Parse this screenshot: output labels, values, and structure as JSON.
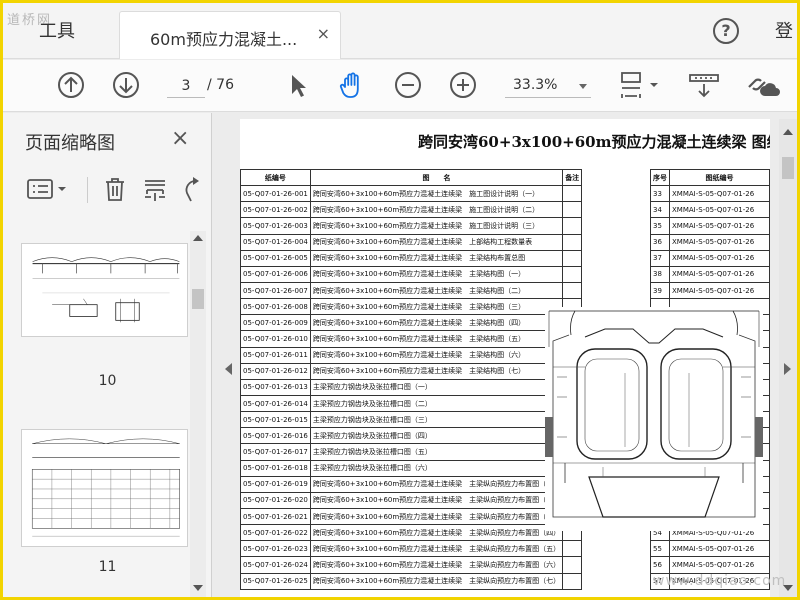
{
  "topbar": {
    "watermark": "道桥网",
    "tools_label": "工具",
    "tab_label": "60m预应力混凝土...",
    "tab_close": "×",
    "help_label": "?",
    "login_label": "登"
  },
  "toolbar": {
    "current_page": "3",
    "total_pages": "/ 76",
    "zoom": "33.3%"
  },
  "panel": {
    "title": "页面缩略图",
    "close": "×",
    "thumbnails": [
      {
        "page": "10"
      },
      {
        "page": "11"
      }
    ]
  },
  "document": {
    "title": "跨同安湾60+3x100+60m预应力混凝土连续梁 图纸",
    "left_headers": [
      "纸编号",
      "图　　名",
      "备注"
    ],
    "rows": [
      {
        "code": "05-Q07-01-26-001",
        "name": "跨同安湾60+3x100+60m预应力混凝土连续梁　施工图设计说明（一）"
      },
      {
        "code": "05-Q07-01-26-002",
        "name": "跨同安湾60+3x100+60m预应力混凝土连续梁　施工图设计说明（二）"
      },
      {
        "code": "05-Q07-01-26-003",
        "name": "跨同安湾60+3x100+60m预应力混凝土连续梁　施工图设计说明（三）"
      },
      {
        "code": "05-Q07-01-26-004",
        "name": "跨同安湾60+3x100+60m预应力混凝土连续梁　上部结构工程数量表"
      },
      {
        "code": "05-Q07-01-26-005",
        "name": "跨同安湾60+3x100+60m预应力混凝土连续梁　主梁结构布置总图"
      },
      {
        "code": "05-Q07-01-26-006",
        "name": "跨同安湾60+3x100+60m预应力混凝土连续梁　主梁结构图（一）"
      },
      {
        "code": "05-Q07-01-26-007",
        "name": "跨同安湾60+3x100+60m预应力混凝土连续梁　主梁结构图（二）"
      },
      {
        "code": "05-Q07-01-26-008",
        "name": "跨同安湾60+3x100+60m预应力混凝土连续梁　主梁结构图（三）"
      },
      {
        "code": "05-Q07-01-26-009",
        "name": "跨同安湾60+3x100+60m预应力混凝土连续梁　主梁结构图（四）"
      },
      {
        "code": "05-Q07-01-26-010",
        "name": "跨同安湾60+3x100+60m预应力混凝土连续梁　主梁结构图（五）"
      },
      {
        "code": "05-Q07-01-26-011",
        "name": "跨同安湾60+3x100+60m预应力混凝土连续梁　主梁结构图（六）"
      },
      {
        "code": "05-Q07-01-26-012",
        "name": "跨同安湾60+3x100+60m预应力混凝土连续梁　主梁结构图（七）"
      },
      {
        "code": "05-Q07-01-26-013",
        "name": "主梁预应力钢齿块及张拉槽口图（一）"
      },
      {
        "code": "05-Q07-01-26-014",
        "name": "主梁预应力钢齿块及张拉槽口图（二）"
      },
      {
        "code": "05-Q07-01-26-015",
        "name": "主梁预应力钢齿块及张拉槽口图（三）"
      },
      {
        "code": "05-Q07-01-26-016",
        "name": "主梁预应力钢齿块及张拉槽口图（四）"
      },
      {
        "code": "05-Q07-01-26-017",
        "name": "主梁预应力钢齿块及张拉槽口图（五）"
      },
      {
        "code": "05-Q07-01-26-018",
        "name": "主梁预应力钢齿块及张拉槽口图（六）"
      },
      {
        "code": "05-Q07-01-26-019",
        "name": "跨同安湾60+3x100+60m预应力混凝土连续梁　主梁纵向预应力布置图（一）"
      },
      {
        "code": "05-Q07-01-26-020",
        "name": "跨同安湾60+3x100+60m预应力混凝土连续梁　主梁纵向预应力布置图（二）"
      },
      {
        "code": "05-Q07-01-26-021",
        "name": "跨同安湾60+3x100+60m预应力混凝土连续梁　主梁纵向预应力布置图（三）"
      },
      {
        "code": "05-Q07-01-26-022",
        "name": "跨同安湾60+3x100+60m预应力混凝土连续梁　主梁纵向预应力布置图（四）"
      },
      {
        "code": "05-Q07-01-26-023",
        "name": "跨同安湾60+3x100+60m预应力混凝土连续梁　主梁纵向预应力布置图（五）"
      },
      {
        "code": "05-Q07-01-26-024",
        "name": "跨同安湾60+3x100+60m预应力混凝土连续梁　主梁纵向预应力布置图（六）"
      },
      {
        "code": "05-Q07-01-26-025",
        "name": "跨同安湾60+3x100+60m预应力混凝土连续梁　主梁纵向预应力布置图（七）"
      }
    ],
    "right_headers": [
      "序号",
      "图纸编号"
    ],
    "right_rows": [
      {
        "no": "33",
        "code": "XMMAI-S-05-Q07-01-26"
      },
      {
        "no": "34",
        "code": "XMMAI-S-05-Q07-01-26"
      },
      {
        "no": "35",
        "code": "XMMAI-S-05-Q07-01-26"
      },
      {
        "no": "36",
        "code": "XMMAI-S-05-Q07-01-26"
      },
      {
        "no": "37",
        "code": "XMMAI-S-05-Q07-01-26"
      },
      {
        "no": "38",
        "code": "XMMAI-S-05-Q07-01-26"
      },
      {
        "no": "39",
        "code": "XMMAI-S-05-Q07-01-26"
      },
      {
        "no": "",
        "code": ""
      },
      {
        "no": "",
        "code": ""
      },
      {
        "no": "",
        "code": ""
      },
      {
        "no": "",
        "code": ""
      },
      {
        "no": "",
        "code": ""
      },
      {
        "no": "",
        "code": ""
      },
      {
        "no": "",
        "code": ""
      },
      {
        "no": "",
        "code": ""
      },
      {
        "no": "",
        "code": ""
      },
      {
        "no": "",
        "code": ""
      },
      {
        "no": "",
        "code": ""
      },
      {
        "no": "",
        "code": ""
      },
      {
        "no": "",
        "code": ""
      },
      {
        "no": "",
        "code": ""
      },
      {
        "no": "54",
        "code": "XMMAI-S-05-Q07-01-26"
      },
      {
        "no": "55",
        "code": "XMMAI-S-05-Q07-01-26"
      },
      {
        "no": "56",
        "code": "XMMAI-S-05-Q07-01-26"
      },
      {
        "no": "57",
        "code": "XMMAI-S-05-Q07-01-26"
      }
    ]
  },
  "footer": {
    "watermark": "www.ddqiao.com"
  }
}
